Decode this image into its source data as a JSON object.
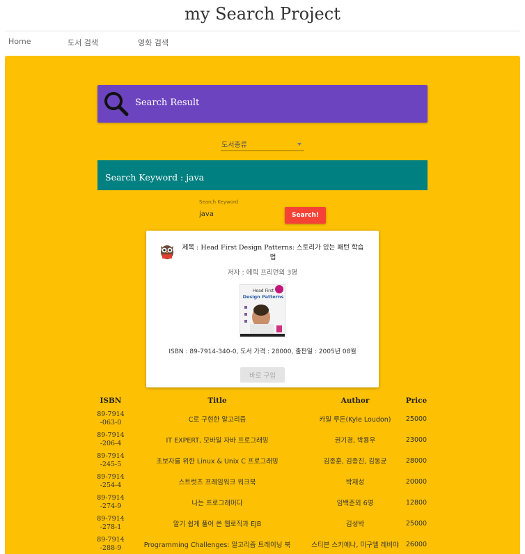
{
  "site": {
    "title": "my Search Project"
  },
  "nav": [
    {
      "label": "Home"
    },
    {
      "label": "도서 검색"
    },
    {
      "label": "영화 검색"
    }
  ],
  "result_banner": {
    "title": "Search Result",
    "icon": "search-icon",
    "color": "#6d44c0"
  },
  "category_select": {
    "selected": "도서종류"
  },
  "keyword_banner": {
    "prefix": "Search Keyword : ",
    "keyword": "java",
    "color": "#008080"
  },
  "search": {
    "label": "Search Keyword",
    "value": "java",
    "button_label": "Search!",
    "button_color": "#f44336"
  },
  "book": {
    "title": "제목 : Head First Design Patterns: 스토리가 있는 패턴 학습법",
    "author": "저자 : 에릭 프리먼외 3명",
    "meta": "ISBN : 89-7914-340-0, 도서 가격 : 28000, 출판일 : 2005년 08월",
    "buy_label": "바로 구입",
    "cover_text_top": "Head First",
    "cover_text_main": "Design Patterns"
  },
  "table": {
    "headers": [
      "ISBN",
      "Title",
      "Author",
      "Price"
    ],
    "rows": [
      {
        "isbn": "89-7914-063-0",
        "title": "C로 구현한 알고리즘",
        "author": "카일 루든(Kyle Loudon)",
        "price": "25000"
      },
      {
        "isbn": "89-7914-206-4",
        "title": "IT EXPERT, 모바일 자바 프로그래밍",
        "author": "권기경, 박용우",
        "price": "23000"
      },
      {
        "isbn": "89-7914-245-5",
        "title": "초보자를 위한 Linux & Unix C 프로그래밍",
        "author": "김종훈, 김종진, 김동균",
        "price": "28000"
      },
      {
        "isbn": "89-7914-254-4",
        "title": "스트럿츠 프레임워크 워크북",
        "author": "박재성",
        "price": "20000"
      },
      {
        "isbn": "89-7914-274-9",
        "title": "나는 프로그래머다",
        "author": "임백준외 6명",
        "price": "12800"
      },
      {
        "isbn": "89-7914-278-1",
        "title": "알기 쉽게 풀어 쓴 웹로직과 EJB",
        "author": "김성박",
        "price": "25000"
      },
      {
        "isbn": "89-7914-288-9",
        "title": "Programming Challenges: 알고리즘 트레이닝 북",
        "author": "스티븐 스키에나, 미구엘 레비야",
        "price": "26000"
      }
    ]
  },
  "colors": {
    "background": "#fdc003"
  }
}
